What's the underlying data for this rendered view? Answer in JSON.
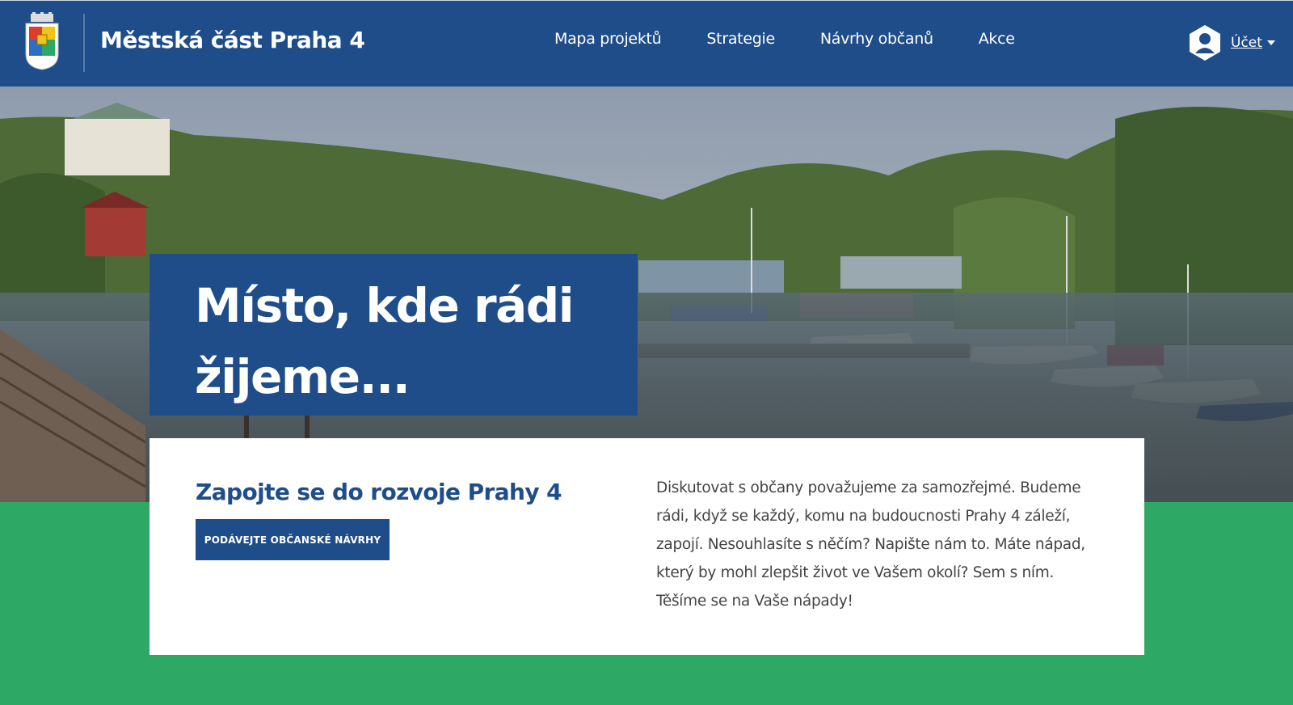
{
  "header": {
    "site_title": "Městská část Praha 4",
    "logo_icon": "coat-of-arms-icon",
    "nav": [
      {
        "label": "Mapa projektů"
      },
      {
        "label": "Strategie"
      },
      {
        "label": "Návrhy občanů"
      },
      {
        "label": "Akce"
      }
    ],
    "account": {
      "label": "Účet",
      "icon": "user-avatar-icon"
    }
  },
  "hero": {
    "title": "Místo, kde rádi žijeme..."
  },
  "card": {
    "heading": "Zapojte se do rozvoje Prahy 4",
    "button_label": "PODÁVEJTE OBČANSKÉ NÁVRHY",
    "text": "Diskutovat s občany považujeme za samozřejmé. Budeme rádi, když se každý, komu na budoucnosti Prahy 4 záleží, zapojí. Nesouhlasíte s něčím? Napište nám to. Máte nápad, který by mohl zlepšit život ve Vašem okolí? Sem s ním. Těšíme se na Vaše nápady!"
  },
  "colors": {
    "brand_blue": "#1e4d8a",
    "footer_green": "#2ea865",
    "card_bg": "#ffffff",
    "text_gray": "#444444"
  }
}
